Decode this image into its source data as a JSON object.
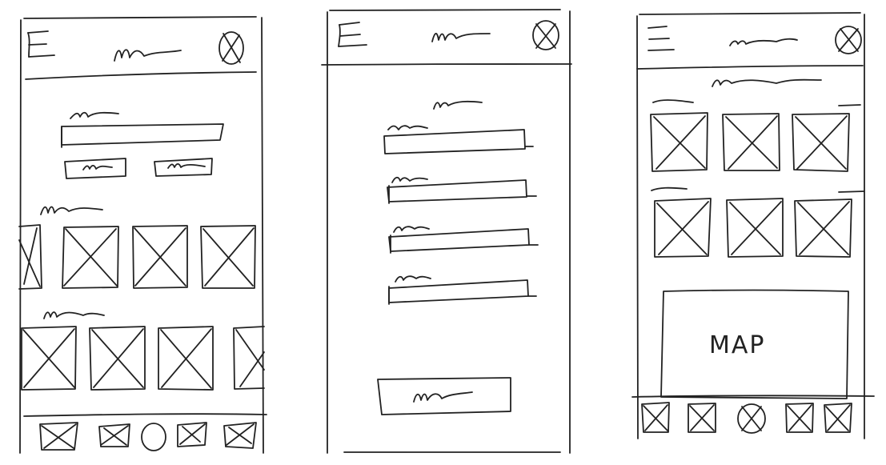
{
  "screens": [
    {
      "id": "home"
    },
    {
      "id": "form"
    },
    {
      "id": "results"
    }
  ],
  "map_label": "MAP",
  "colors": {
    "ink": "#222222",
    "paper": "#ffffff"
  },
  "icons": [
    "hamburger-menu-icon",
    "avatar-icon",
    "image-placeholder-icon",
    "nav-icon"
  ]
}
